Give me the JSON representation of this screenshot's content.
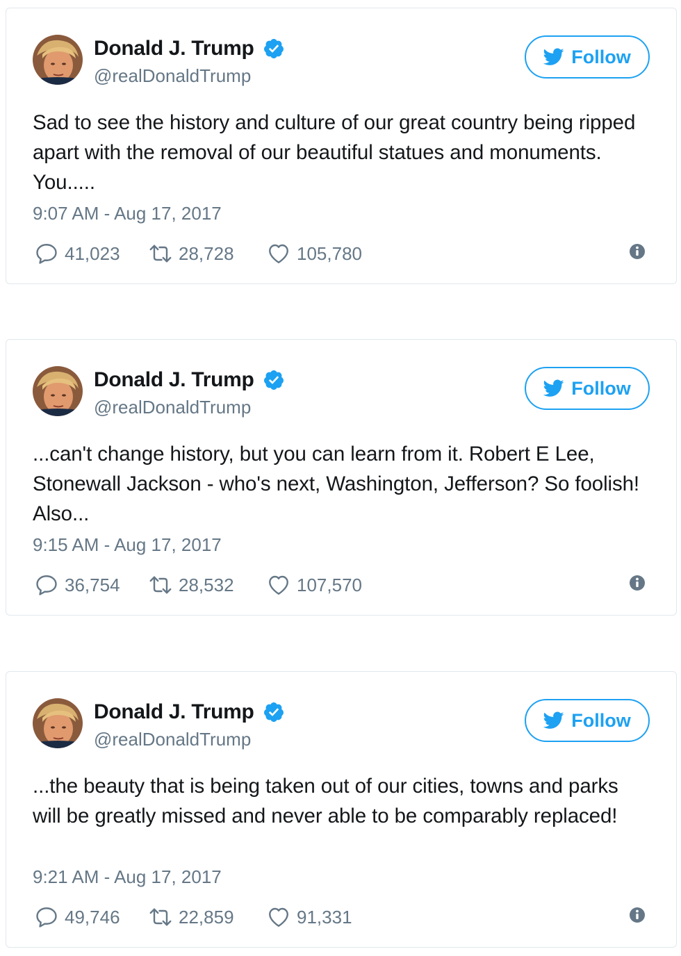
{
  "colors": {
    "accent": "#1da1f2",
    "verified": "#1da1f2",
    "text": "#14171a",
    "muted": "#657786",
    "border": "#e1e8ed"
  },
  "icons": {
    "verified": "verified-badge-icon",
    "follow": "twitter-bird-icon",
    "reply": "reply-bubble-icon",
    "retweet": "retweet-icon",
    "like": "heart-icon",
    "info": "info-icon"
  },
  "follow_label": "Follow",
  "tweets": [
    {
      "author": {
        "name": "Donald J. Trump",
        "handle": "@realDonaldTrump",
        "verified": true
      },
      "text": "Sad to see the history and culture of our great country being ripped apart with the removal of our beautiful statues and monuments. You.....",
      "timestamp": "9:07 AM - Aug 17, 2017",
      "replies": "41,023",
      "retweets": "28,728",
      "likes": "105,780"
    },
    {
      "author": {
        "name": "Donald J. Trump",
        "handle": "@realDonaldTrump",
        "verified": true
      },
      "text": "...can't change history, but you can learn from it. Robert E Lee, Stonewall Jackson - who's next, Washington, Jefferson? So foolish! Also...",
      "timestamp": "9:15 AM - Aug 17, 2017",
      "replies": "36,754",
      "retweets": "28,532",
      "likes": "107,570"
    },
    {
      "author": {
        "name": "Donald J. Trump",
        "handle": "@realDonaldTrump",
        "verified": true
      },
      "text": "...the beauty that is being taken out of our cities, towns and parks will be greatly missed and never able to be comparably replaced!",
      "timestamp": "9:21 AM - Aug 17, 2017",
      "replies": "49,746",
      "retweets": "22,859",
      "likes": "91,331"
    }
  ]
}
